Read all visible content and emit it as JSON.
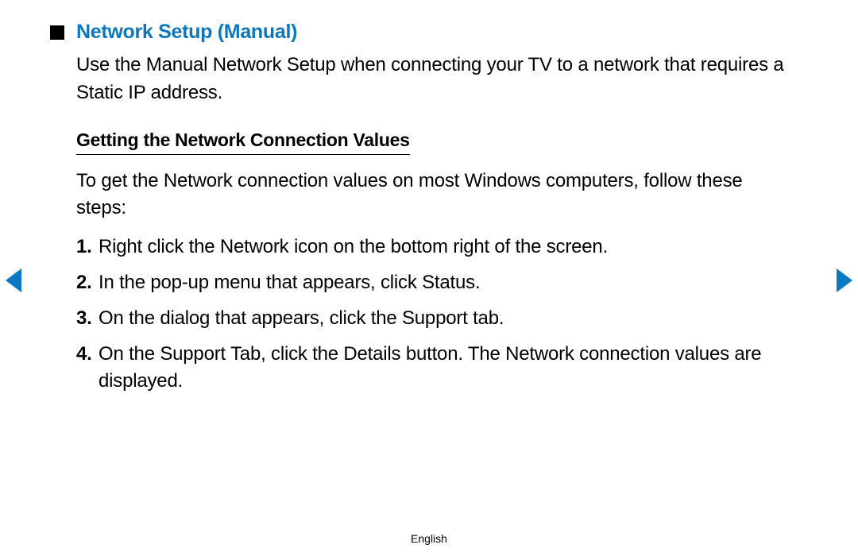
{
  "section": {
    "title": "Network Setup (Manual)",
    "intro": "Use the Manual Network Setup when connecting your TV to a network that requires a Static IP address."
  },
  "subsection": {
    "title": "Getting the Network Connection Values",
    "intro": "To get the Network connection values on most Windows computers, follow these steps:",
    "steps": [
      "Right click the Network icon on the bottom right of the screen.",
      "In the pop-up menu that appears, click Status.",
      "On the dialog that appears, click the Support tab.",
      "On the Support Tab, click the Details button. The Network connection values are displayed."
    ]
  },
  "footer": {
    "language": "English"
  }
}
